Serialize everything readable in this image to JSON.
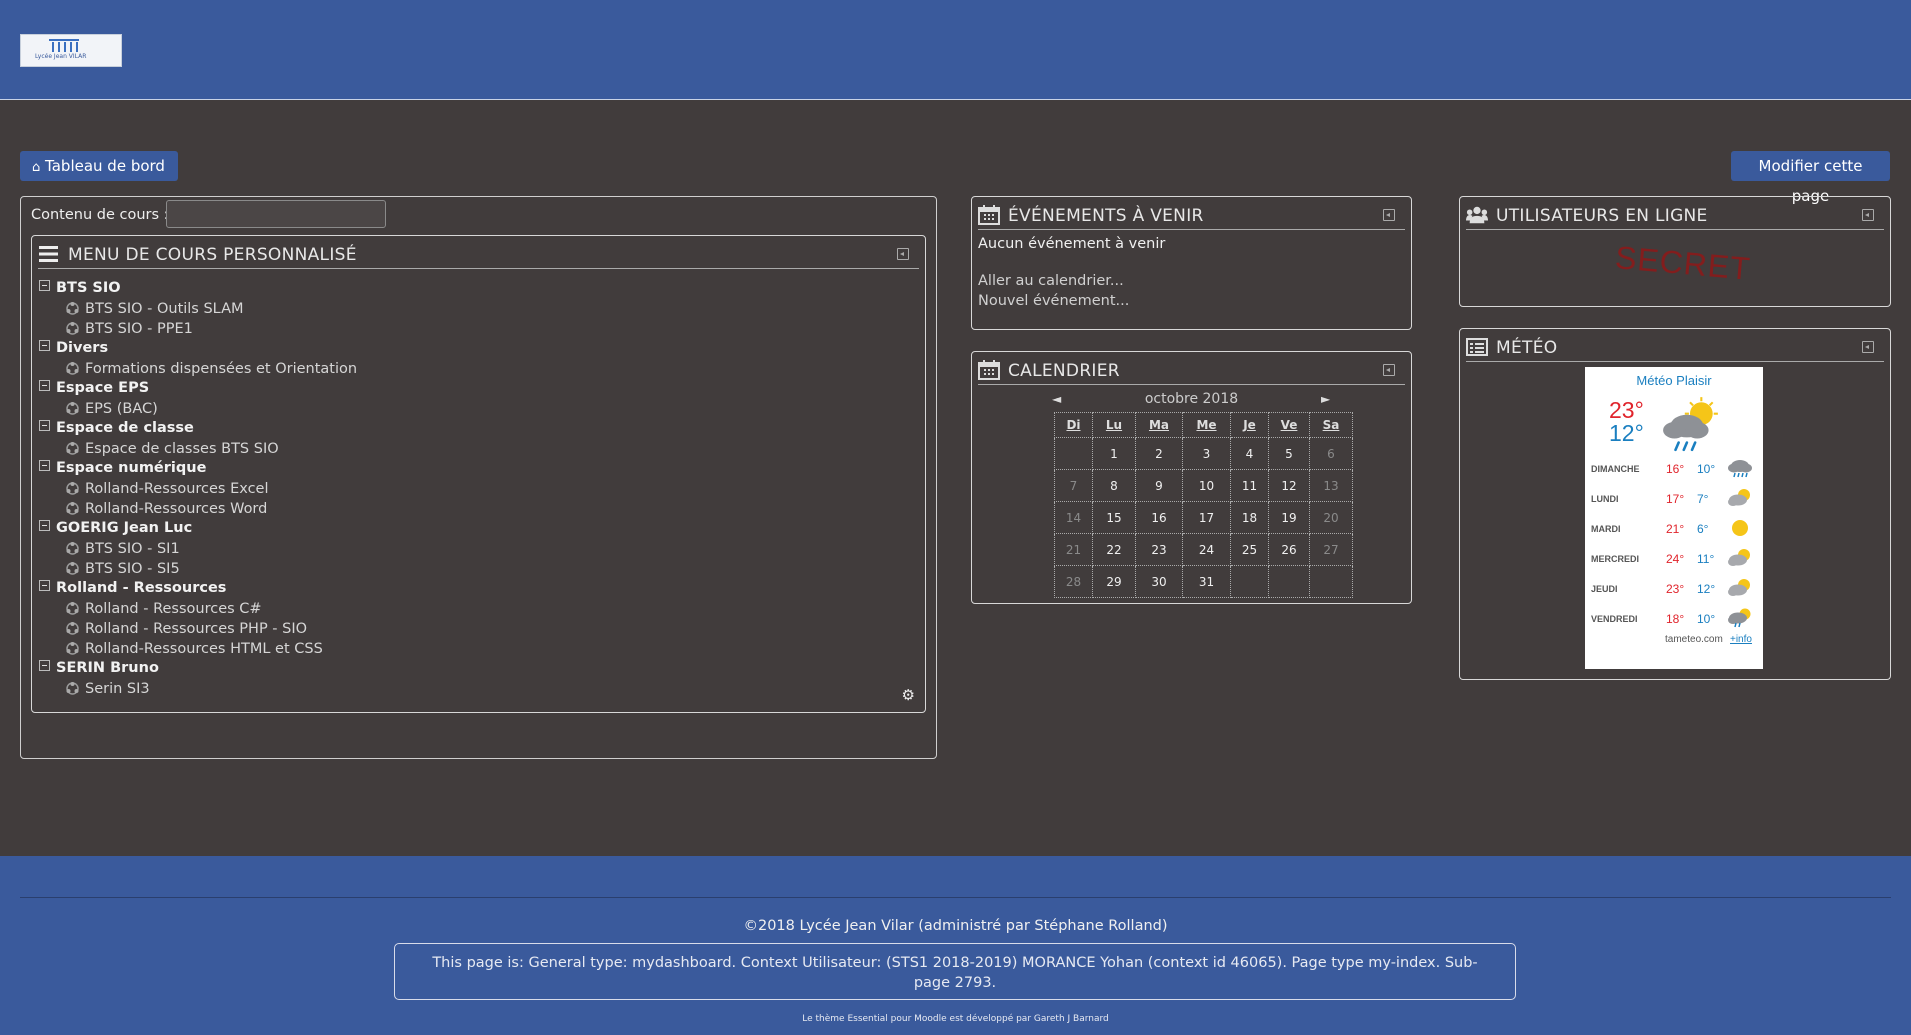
{
  "header": {
    "logo_text": "Lycée Jean VILAR"
  },
  "buttons": {
    "dashboard": "Tableau de bord",
    "edit_page": "Modifier cette page"
  },
  "course_menu": {
    "search_label": "Contenu de cours :",
    "search_value": "",
    "title": "MENU DE COURS PERSONNALISÉ",
    "categories": [
      {
        "name": "BTS SIO",
        "courses": [
          "BTS SIO - Outils SLAM",
          "BTS SIO - PPE1"
        ]
      },
      {
        "name": "Divers",
        "courses": [
          "Formations dispensées et Orientation"
        ]
      },
      {
        "name": "Espace EPS",
        "courses": [
          "EPS (BAC)"
        ]
      },
      {
        "name": "Espace de classe",
        "courses": [
          "Espace de classes BTS SIO"
        ]
      },
      {
        "name": "Espace numérique",
        "courses": [
          "Rolland-Ressources Excel",
          "Rolland-Ressources Word"
        ]
      },
      {
        "name": "GOERIG Jean Luc",
        "courses": [
          "BTS SIO - SI1",
          "BTS SIO - SI5"
        ]
      },
      {
        "name": "Rolland - Ressources",
        "courses": [
          "Rolland - Ressources C#",
          "Rolland - Ressources PHP - SIO",
          "Rolland-Ressources HTML et CSS"
        ]
      },
      {
        "name": "SERIN Bruno",
        "courses": [
          "Serin SI3"
        ]
      }
    ]
  },
  "events": {
    "title": "ÉVÉNEMENTS À VENIR",
    "empty": "Aucun événement à venir",
    "goto_calendar": "Aller au calendrier...",
    "new_event": "Nouvel événement..."
  },
  "calendar": {
    "title": "CALENDRIER",
    "month": "octobre 2018",
    "prev": "◄",
    "next": "►",
    "weekdays": [
      "Di",
      "Lu",
      "Ma",
      "Me",
      "Je",
      "Ve",
      "Sa"
    ],
    "weeks": [
      [
        "",
        "1",
        "2",
        "3",
        "4",
        "5",
        "6"
      ],
      [
        "7",
        "8",
        "9",
        "10",
        "11",
        "12",
        "13"
      ],
      [
        "14",
        "15",
        "16",
        "17",
        "18",
        "19",
        "20"
      ],
      [
        "21",
        "22",
        "23",
        "24",
        "25",
        "26",
        "27"
      ],
      [
        "28",
        "29",
        "30",
        "31",
        "",
        "",
        ""
      ]
    ]
  },
  "online_users": {
    "title": "UTILISATEURS EN LIGNE",
    "stamp": "SECRET"
  },
  "weather": {
    "title": "MÉTÉO",
    "widget_title": "Météo Plaisir",
    "today_high": "23°",
    "today_low": "12°",
    "days": [
      {
        "day": "DIMANCHE",
        "high": "16°",
        "low": "10°",
        "icon": "rain-cloud"
      },
      {
        "day": "LUNDI",
        "high": "17°",
        "low": "7°",
        "icon": "cloud-sun"
      },
      {
        "day": "MARDI",
        "high": "21°",
        "low": "6°",
        "icon": "sun"
      },
      {
        "day": "MERCREDI",
        "high": "24°",
        "low": "11°",
        "icon": "cloud-sun"
      },
      {
        "day": "JEUDI",
        "high": "23°",
        "low": "12°",
        "icon": "cloud-sun"
      },
      {
        "day": "VENDREDI",
        "high": "18°",
        "low": "10°",
        "icon": "rain-sun"
      }
    ],
    "source": "tameteo.com",
    "more": "+info"
  },
  "footer": {
    "copyright": "©2018 Lycée Jean Vilar (administré par Stéphane Rolland)",
    "page_info": "This page is: General type: mydashboard. Context Utilisateur: (STS1 2018-2019) MORANCE Yohan (context id 46065). Page type my-index. Sub-page 2793.",
    "credit": "Le thème Essential pour Moodle est développé par Gareth J Barnard"
  },
  "colors": {
    "header": "#3a5a9c",
    "body": "#413c3c",
    "hot": "#e0242c",
    "cold": "#1a7fc0"
  }
}
